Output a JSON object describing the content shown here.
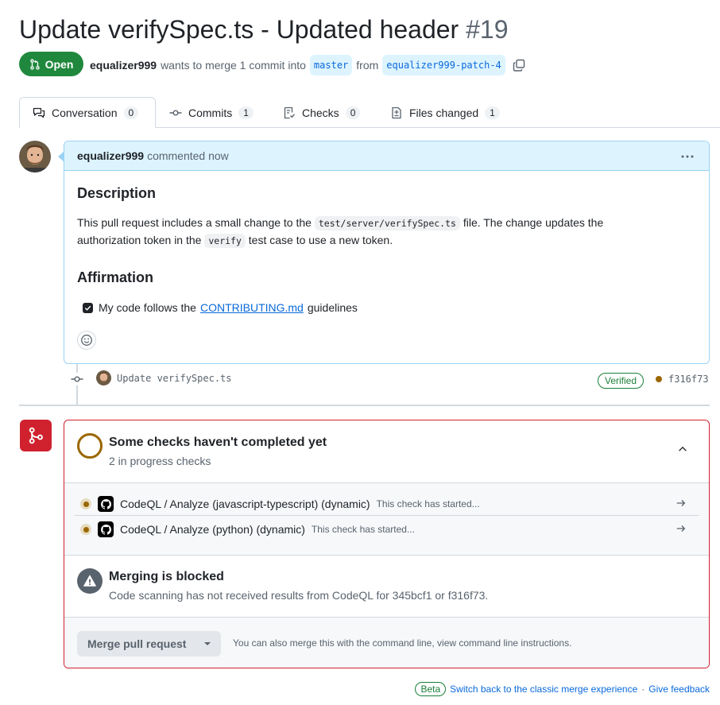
{
  "pr": {
    "title": "Update verifySpec.ts - Updated header",
    "number": "#19",
    "state": "Open",
    "author": "equalizer999",
    "merge_text": "wants to merge 1 commit into",
    "base_branch": "master",
    "from_text": "from",
    "head_branch": "equalizer999-patch-4"
  },
  "tabs": [
    {
      "label": "Conversation",
      "count": "0",
      "icon": "conversation-icon"
    },
    {
      "label": "Commits",
      "count": "1",
      "icon": "commit-icon"
    },
    {
      "label": "Checks",
      "count": "0",
      "icon": "checklist-icon"
    },
    {
      "label": "Files changed",
      "count": "1",
      "icon": "file-diff-icon"
    }
  ],
  "comment": {
    "author": "equalizer999",
    "time": "commented now",
    "h_description": "Description",
    "p1_a": "This pull request includes a small change to the",
    "p1_code": "test/server/verifySpec.ts",
    "p1_b": "file. The change updates the",
    "p2_a": "authorization token in the",
    "p2_code": "verify",
    "p2_b": "test case to use a new token.",
    "h_affirmation": "Affirmation",
    "check_a": "My code follows the",
    "check_link": "CONTRIBUTING.md",
    "check_b": "guidelines"
  },
  "commit": {
    "message": "Update verifySpec.ts",
    "verified": "Verified",
    "sha": "f316f73",
    "status_color": "#9a6700"
  },
  "checks": {
    "title": "Some checks haven't completed yet",
    "subtitle": "2 in progress checks",
    "items": [
      {
        "name": "CodeQL / Analyze (javascript-typescript) (dynamic)",
        "status": "This check has started..."
      },
      {
        "name": "CodeQL / Analyze (python) (dynamic)",
        "status": "This check has started..."
      }
    ]
  },
  "blocked": {
    "title": "Merging is blocked",
    "description": "Code scanning has not received results from CodeQL for 345bcf1 or f316f73."
  },
  "merge": {
    "button": "Merge pull request",
    "hint": "You can also merge this with the command line, view command line instructions."
  },
  "footer": {
    "beta": "Beta",
    "classic": "Switch back to the classic merge experience",
    "separator": "·",
    "feedback": "Give feedback"
  },
  "colors": {
    "open": "#1f883d",
    "blocked": "#cf222e",
    "pending": "#9a6700",
    "link": "#0969da"
  }
}
